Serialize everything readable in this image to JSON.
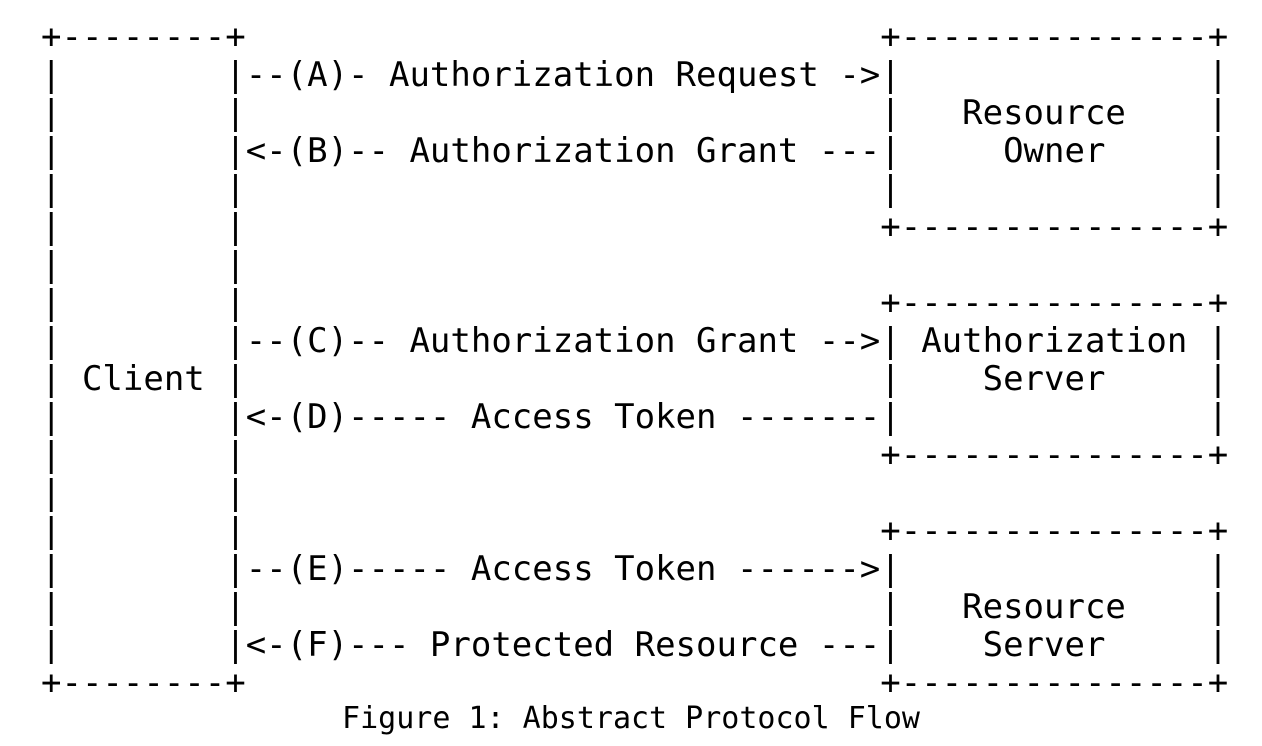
{
  "figure": {
    "caption": "Figure 1: Abstract Protocol Flow",
    "title": "Abstract Protocol Flow",
    "colors": {
      "background": "#ffffff",
      "text": "#000000"
    },
    "nodes": [
      {
        "id": "client",
        "label": "Client",
        "box_width_dashes": 8
      },
      {
        "id": "resource-owner",
        "label_line1": "Resource",
        "label_line2": "Owner",
        "box_width_dashes": 14
      },
      {
        "id": "authorization-server",
        "label_line1": "Authorization",
        "label_line2": "Server",
        "box_width_dashes": 14
      },
      {
        "id": "resource-server",
        "label_line1": "Resource",
        "label_line2": "Server",
        "box_width_dashes": 14
      }
    ],
    "flows": [
      {
        "step": "A",
        "label": "Authorization Request",
        "direction": "client-to-resource-owner"
      },
      {
        "step": "B",
        "label": "Authorization Grant",
        "direction": "resource-owner-to-client"
      },
      {
        "step": "C",
        "label": "Authorization Grant",
        "direction": "client-to-authorization-server"
      },
      {
        "step": "D",
        "label": "Access Token",
        "direction": "authorization-server-to-client"
      },
      {
        "step": "E",
        "label": "Access Token",
        "direction": "client-to-resource-server"
      },
      {
        "step": "F",
        "label": "Protected Resource",
        "direction": "resource-server-to-client"
      }
    ],
    "rows": [
      "+--------+                               +---------------+",
      "|        |--(A)- Authorization Request ->|               |",
      "|        |                               |   Resource    |",
      "|        |<-(B)-- Authorization Grant ---|     Owner     |",
      "|        |                               |               |",
      "|        |                               +---------------+",
      "|        |",
      "|        |                               +---------------+",
      "|        |--(C)-- Authorization Grant -->| Authorization |",
      "| Client |                               |    Server     |",
      "|        |<-(D)----- Access Token -------|               |",
      "|        |                               +---------------+",
      "|        |",
      "|        |                               +---------------+",
      "|        |--(E)----- Access Token ------>|               |",
      "|        |                               |   Resource    |",
      "|        |<-(F)--- Protected Resource ---|    Server     |",
      "+--------+                               +---------------+"
    ]
  }
}
